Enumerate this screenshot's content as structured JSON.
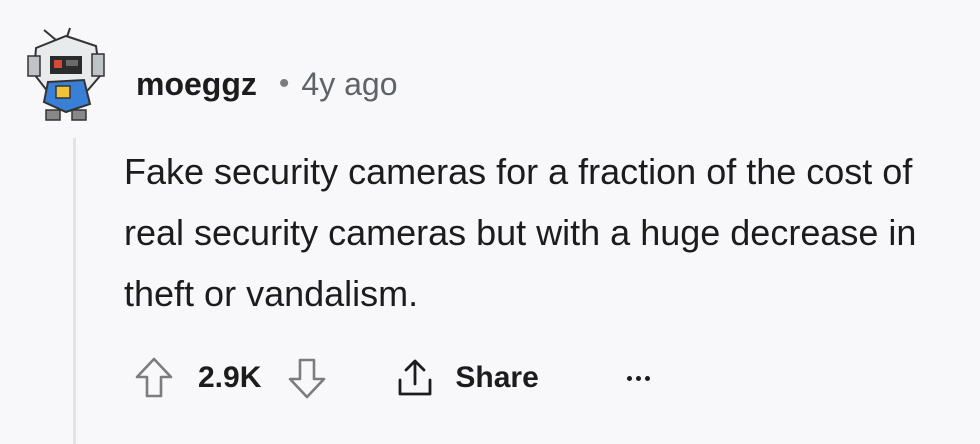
{
  "comment": {
    "author": "moeggz",
    "separator": "•",
    "timestamp": "4y ago",
    "text": "Fake security cameras for a fraction of the cost of real security cameras but with a huge decrease in theft or vandalism.",
    "vote_count": "2.9K",
    "share_label": "Share"
  },
  "icons": {
    "avatar": "snoo-robot-avatar",
    "upvote": "upvote-arrow-icon",
    "downvote": "downvote-arrow-icon",
    "share": "share-icon",
    "more": "more-dots-icon"
  },
  "colors": {
    "background": "#f8f8fa",
    "text": "#1c1c1c",
    "muted": "#5f6266",
    "thread_line": "#e3e3e6",
    "avatar_blue": "#3a7fd6"
  }
}
